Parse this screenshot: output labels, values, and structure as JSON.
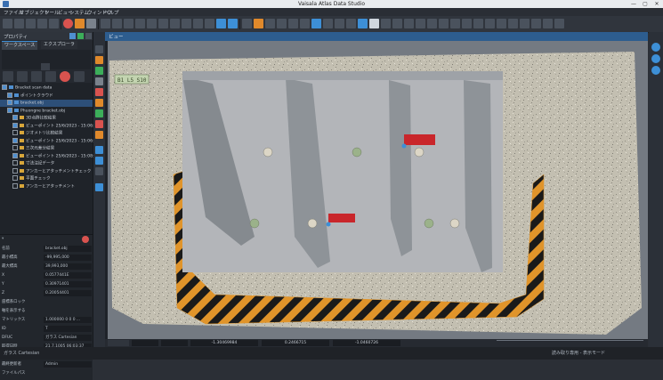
{
  "window": {
    "title": "Vaisala Atlas Data Studio",
    "controls": [
      "—",
      "▢",
      "✕"
    ]
  },
  "menu": [
    "ファイル",
    "オブジェクト",
    "ツール",
    "ビュー",
    "システム",
    "ウィンドウ",
    "ヘルプ"
  ],
  "left_panel": {
    "header": "プロパティ",
    "tabs": [
      "ワークスペース",
      "エクスプローラ"
    ],
    "tree": [
      {
        "label": "Bracket scan data",
        "indent": 0,
        "type": "group",
        "checked": true,
        "selected": false
      },
      {
        "label": "ポイントクラウド",
        "indent": 1,
        "type": "blue",
        "checked": true,
        "selected": false
      },
      {
        "label": "bracket.obj",
        "indent": 1,
        "type": "blue",
        "checked": true,
        "selected": true
      },
      {
        "label": "Phuongne bracket.obj",
        "indent": 1,
        "type": "blue",
        "checked": true,
        "selected": false
      },
      {
        "label": "3D点群比較結果",
        "indent": 2,
        "type": "folder",
        "checked": true,
        "selected": false
      },
      {
        "label": "ビューポイント 25/6/2023 - 15:06:19",
        "indent": 2,
        "type": "folder",
        "checked": true,
        "selected": false
      },
      {
        "label": "ジオメトリ比較結果",
        "indent": 2,
        "type": "folder",
        "checked": false,
        "selected": false
      },
      {
        "label": "ビューポイント 25/6/2023 - 15:06:53",
        "indent": 2,
        "type": "folder",
        "checked": true,
        "selected": false
      },
      {
        "label": "三次元差分結果",
        "indent": 2,
        "type": "folder",
        "checked": false,
        "selected": false
      },
      {
        "label": "ビューポイント 25/6/2023 - 15:08:07",
        "indent": 2,
        "type": "folder",
        "checked": true,
        "selected": false
      },
      {
        "label": "寸法注記データ",
        "indent": 2,
        "type": "folder",
        "checked": false,
        "selected": false
      },
      {
        "label": "アンカーとアタッチメントチェック",
        "indent": 2,
        "type": "folder",
        "checked": false,
        "selected": false
      },
      {
        "label": "平面チェック",
        "indent": 2,
        "type": "folder",
        "checked": false,
        "selected": false
      },
      {
        "label": "アンカーとアタッチメント",
        "indent": 2,
        "type": "folder",
        "checked": false,
        "selected": false
      }
    ],
    "properties": [
      {
        "key": "名前",
        "value": "bracket.obj"
      },
      {
        "key": "最小標高",
        "value": "-99,995,000"
      },
      {
        "key": "最大標高",
        "value": "39,993,000"
      },
      {
        "key": "X",
        "value": "0.0577441E"
      },
      {
        "key": "Y",
        "value": "0.30971401"
      },
      {
        "key": "Z",
        "value": "0.20054401"
      },
      {
        "key": "座標系ロック",
        "value": ""
      },
      {
        "key": "軸を表示する",
        "value": ""
      },
      {
        "key": "マトリックス",
        "value": "1.000000 0 0 0 ..."
      },
      {
        "key": "ID",
        "value": "T"
      },
      {
        "key": "DFUC",
        "value": "ガラス Cartesian"
      },
      {
        "key": "取得日時",
        "value": "21.7.1005 06:03:37"
      },
      {
        "key": "最終更新日時",
        "value": "21.7.1005 06:03:37"
      },
      {
        "key": "最終更新者",
        "value": "Admin"
      },
      {
        "key": "ファイルパス",
        "value": ""
      }
    ]
  },
  "viewport": {
    "tab_label": "ビュー",
    "colors": {
      "background": "#747a82",
      "pointcloud": "#c6c2b4",
      "concrete": "#b2b4b8",
      "hazard_black": "#1a1a1a",
      "hazard_orange": "#e0942a",
      "marker_red": "#c9262b",
      "anchor_green": "#9bb28a"
    },
    "label_tag": "B1 L5 S10",
    "bottom_fields": [
      "-1.30469984",
      "0.2466715",
      "-1.0460726"
    ]
  },
  "status": {
    "left": "ガラス Cartesian",
    "right": "読み取り専用 - 表示モード"
  }
}
